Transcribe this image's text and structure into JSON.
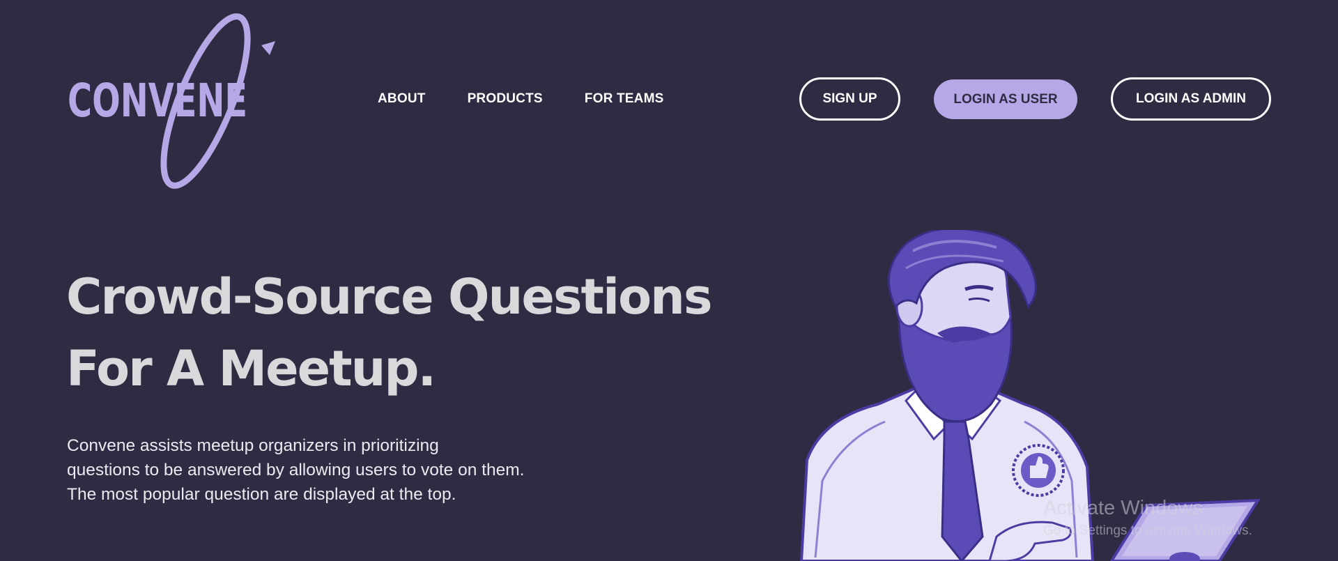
{
  "brand": {
    "logo_text": "CONVENE",
    "logo_color": "#b6a8e6"
  },
  "nav": {
    "items": [
      {
        "label": "ABOUT"
      },
      {
        "label": "PRODUCTS"
      },
      {
        "label": "FOR TEAMS"
      }
    ]
  },
  "auth": {
    "signup_label": "SIGN UP",
    "login_user_label": "LOGIN AS USER",
    "login_admin_label": "LOGIN AS ADMIN"
  },
  "hero": {
    "title_lines": [
      "Crowd-Source Questions",
      "For A Meetup."
    ],
    "description_lines": [
      "Convene assists meetup organizers in prioritizing",
      "questions to be answered by allowing users to vote on them.",
      "The most popular question are displayed at the top."
    ]
  },
  "illustration": {
    "icons": [
      "man-with-beard",
      "thumbs-up-badge",
      "laptop"
    ]
  },
  "watermark": {
    "title": "Activate Windows",
    "subtitle": "Go to Settings to activate Windows."
  },
  "colors": {
    "background": "#2f2b42",
    "accent": "#b6a8e6",
    "heading": "#d9d9dc",
    "text": "#ebeaf0",
    "illustration_primary": "#5b4bb7"
  }
}
